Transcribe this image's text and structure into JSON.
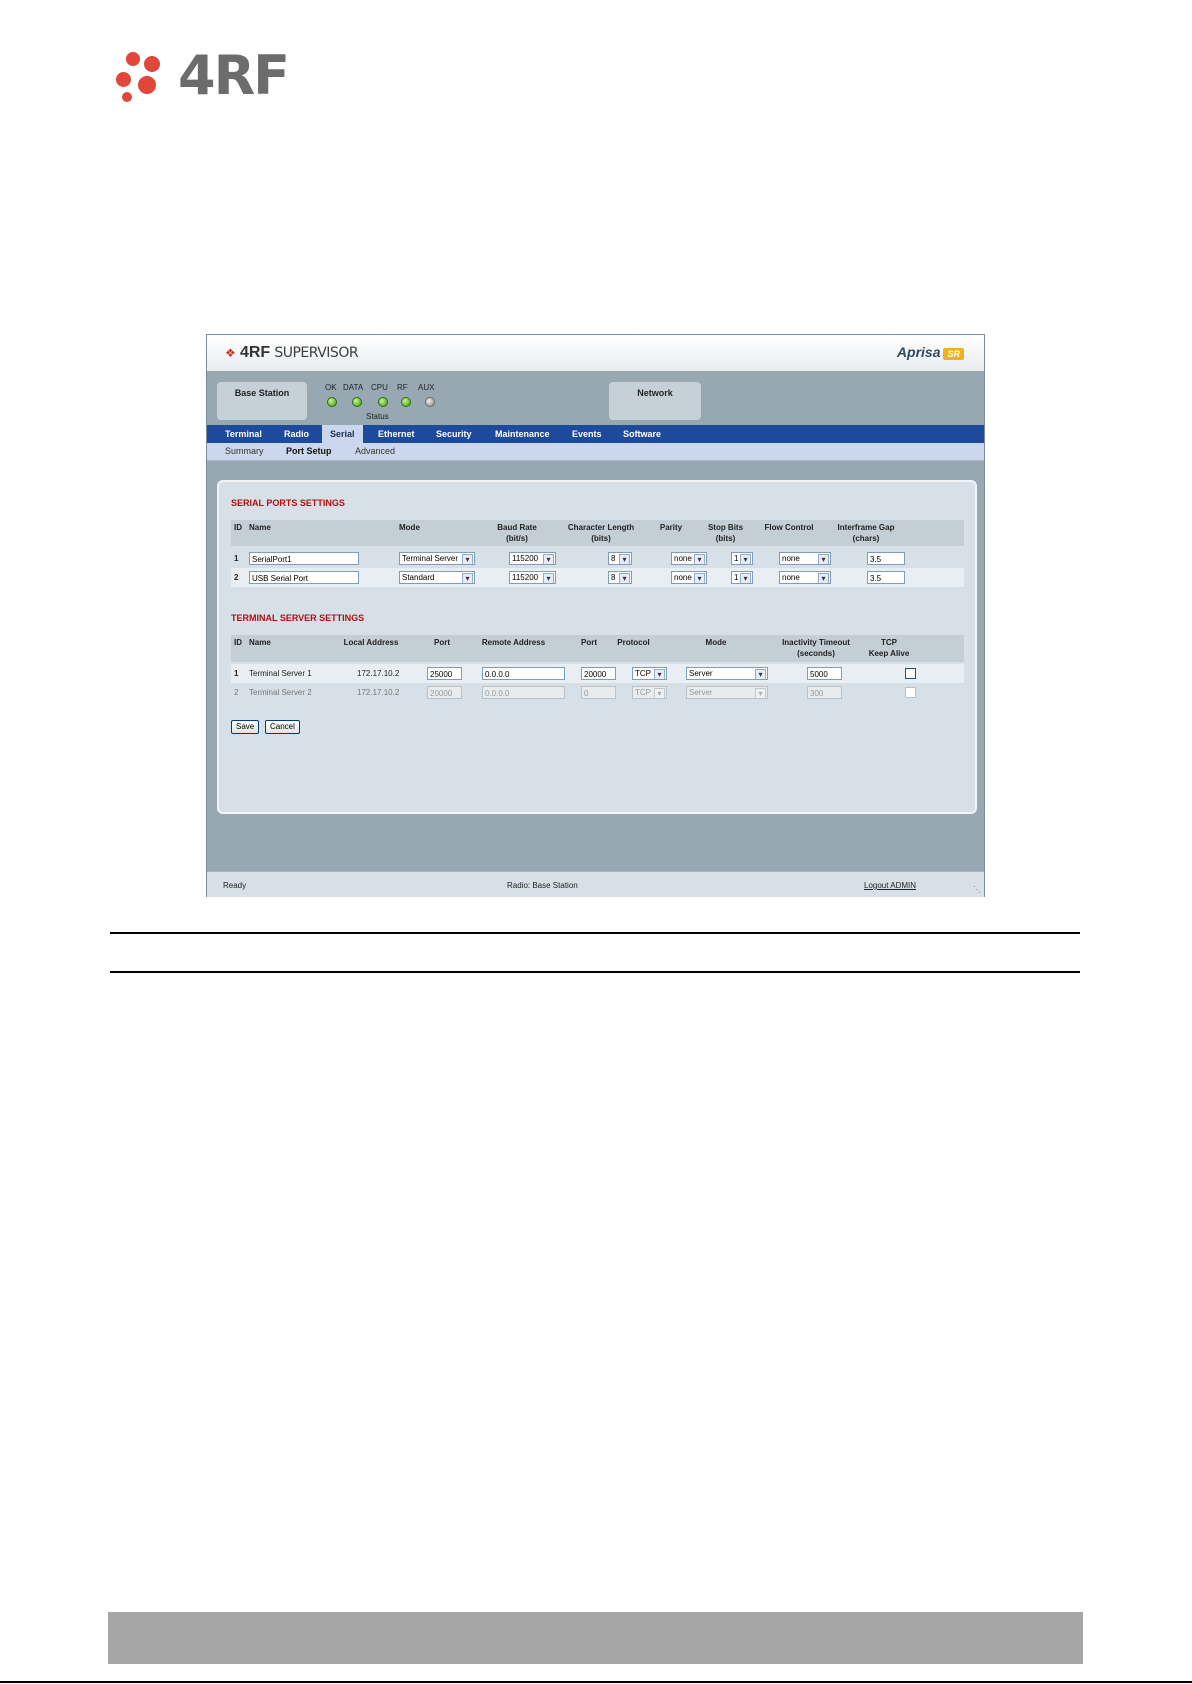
{
  "page": {
    "logo_text": "4RF"
  },
  "app": {
    "brand": {
      "mark": "4RF",
      "name": "SUPERVISOR"
    },
    "product": {
      "name": "Aprisa",
      "badge": "SR"
    },
    "panels": {
      "base_station": "Base Station",
      "network": "Network"
    },
    "leds": [
      {
        "label": "OK",
        "state": "on"
      },
      {
        "label": "DATA",
        "state": "on"
      },
      {
        "label": "CPU",
        "state": "on"
      },
      {
        "label": "RF",
        "state": "on"
      },
      {
        "label": "AUX",
        "state": "off"
      }
    ],
    "status_label": "Status",
    "tabs": [
      "Terminal",
      "Radio",
      "Serial",
      "Ethernet",
      "Security",
      "Maintenance",
      "Events",
      "Software"
    ],
    "active_tab": "Serial",
    "subtabs": [
      "Summary",
      "Port Setup",
      "Advanced"
    ],
    "active_subtab": "Port Setup",
    "serial": {
      "title": "SERIAL PORTS SETTINGS",
      "headers": {
        "id": "ID",
        "name": "Name",
        "mode": "Mode",
        "baud1": "Baud Rate",
        "baud2": "(bit/s)",
        "char1": "Character Length",
        "char2": "(bits)",
        "parity": "Parity",
        "stop1": "Stop Bits",
        "stop2": "(bits)",
        "flow": "Flow Control",
        "gap1": "Interframe Gap",
        "gap2": "(chars)"
      },
      "rows": [
        {
          "id": "1",
          "name": "SerialPort1",
          "mode": "Terminal Server",
          "baud": "115200",
          "char_len": "8",
          "parity": "none",
          "stop": "1",
          "flow": "none",
          "gap": "3.5"
        },
        {
          "id": "2",
          "name": "USB Serial Port",
          "mode": "Standard",
          "baud": "115200",
          "char_len": "8",
          "parity": "none",
          "stop": "1",
          "flow": "none",
          "gap": "3.5"
        }
      ]
    },
    "terminal": {
      "title": "TERMINAL SERVER SETTINGS",
      "headers": {
        "id": "ID",
        "name": "Name",
        "local": "Local Address",
        "port": "Port",
        "remote": "Remote Address",
        "port2": "Port",
        "protocol": "Protocol",
        "mode": "Mode",
        "timeout1": "Inactivity Timeout",
        "timeout2": "(seconds)",
        "tcp1": "TCP",
        "tcp2": "Keep Alive"
      },
      "rows": [
        {
          "id": "1",
          "name": "Terminal Server 1",
          "local": "172.17.10.2",
          "port": "25000",
          "remote": "0.0.0.0",
          "rport": "20000",
          "protocol": "TCP",
          "mode": "Server",
          "timeout": "5000",
          "keepalive": false,
          "enabled": true
        },
        {
          "id": "2",
          "name": "Terminal Server 2",
          "local": "172.17.10.2",
          "port": "20000",
          "remote": "0.0.0.0",
          "rport": "0",
          "protocol": "TCP",
          "mode": "Server",
          "timeout": "300",
          "keepalive": false,
          "enabled": false
        }
      ]
    },
    "buttons": {
      "save": "Save",
      "cancel": "Cancel"
    },
    "statusbar": {
      "left": "Ready",
      "center": "Radio: Base Station",
      "right": "Logout ADMIN"
    }
  }
}
